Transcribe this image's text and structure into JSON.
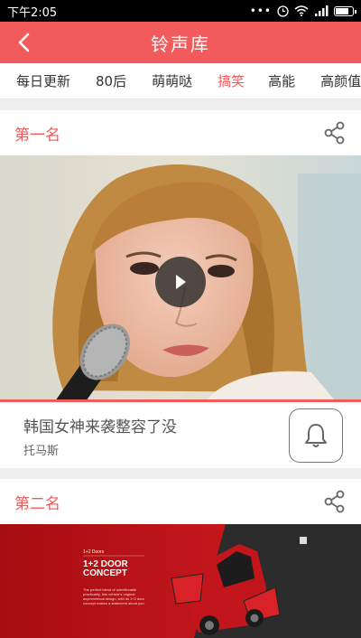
{
  "status_bar": {
    "time": "下午2:05",
    "icons": [
      "dots-icon",
      "clock-icon",
      "wifi-icon",
      "signal-icon",
      "battery-icon"
    ]
  },
  "app_bar": {
    "title": "铃声库",
    "back_icon": "chevron-left-icon"
  },
  "tabs": [
    {
      "label": "每日更新",
      "active": false
    },
    {
      "label": "80后",
      "active": false
    },
    {
      "label": "萌萌哒",
      "active": false
    },
    {
      "label": "搞笑",
      "active": true
    },
    {
      "label": "高能",
      "active": false
    },
    {
      "label": "高颜值",
      "active": false
    }
  ],
  "rankings": [
    {
      "rank_label": "第一名",
      "song_title": "韩国女神来袭整容了没",
      "artist": "托马斯",
      "media": "video-thumbnail"
    },
    {
      "rank_label": "第二名",
      "media": "car-ad-image",
      "image_text": {
        "small": "1+2 Doors",
        "heading": "1+2 DOOR CONCEPT",
        "description": "The perfect blend of unbelievable practicality, this vehicle's original asymmetrical design, with its 1+2 door concept makes a statement about you."
      }
    }
  ],
  "colors": {
    "accent": "#f25b5b",
    "status_bar": "#000000",
    "background": "#eeeeee"
  }
}
